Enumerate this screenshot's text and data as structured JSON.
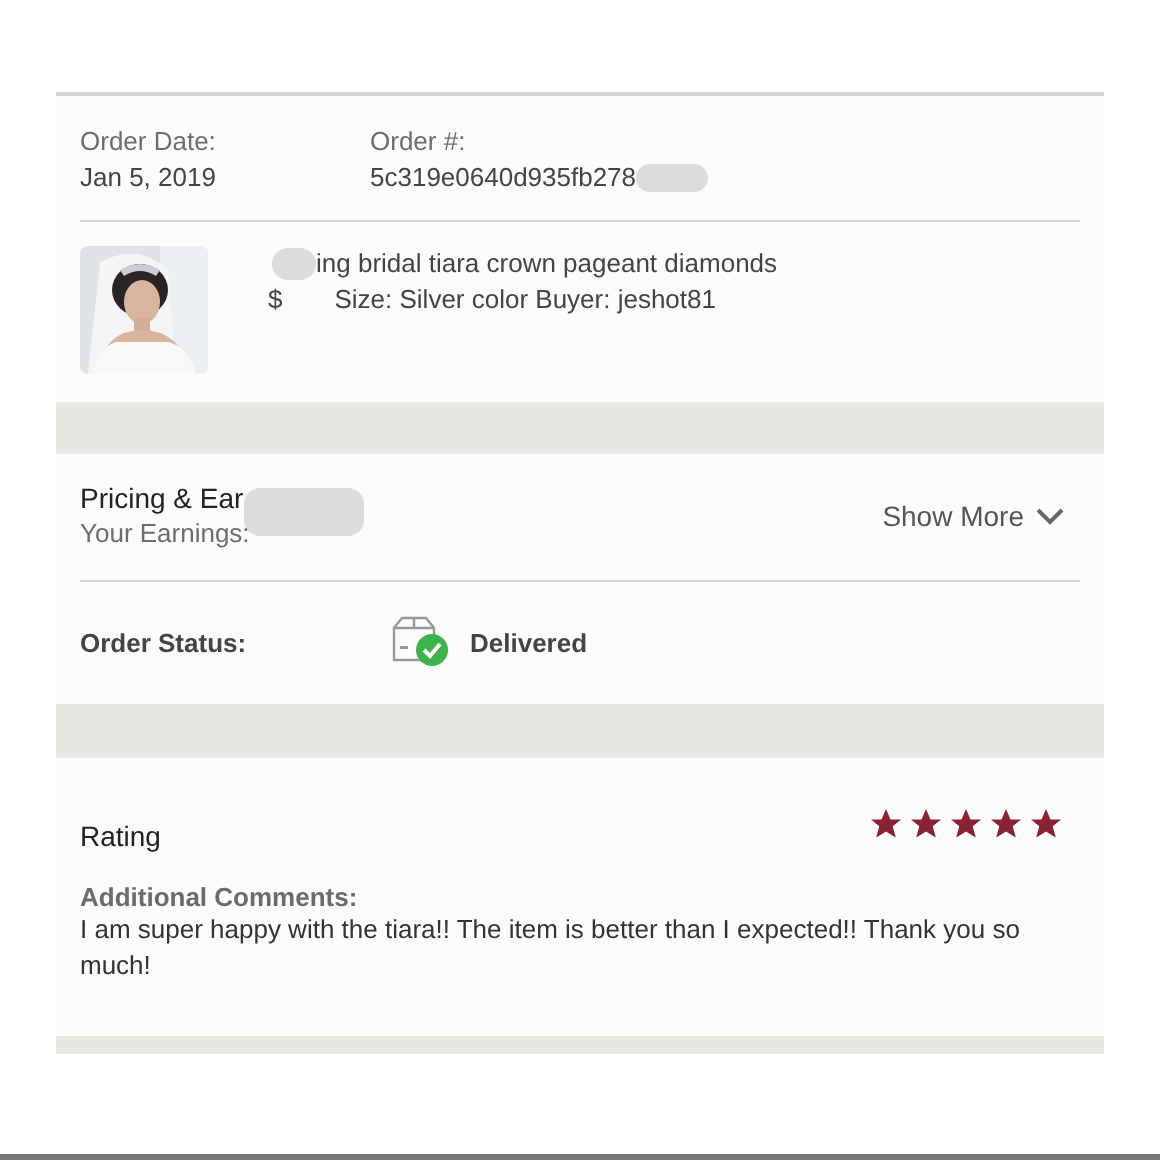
{
  "order": {
    "date_label": "Order Date:",
    "date": "Jan 5, 2019",
    "number_label": "Order #:",
    "number": "5c319e0640d935fb278"
  },
  "item": {
    "title": "ing bridal tiara crown pageant diamonds",
    "price_prefix": "$",
    "details": "Size: Silver color  Buyer: jeshot81"
  },
  "pricing": {
    "title": "Pricing & Ear",
    "earnings_label": "Your Earnings:",
    "toggle": "Show More"
  },
  "status": {
    "label": "Order Status:",
    "value": "Delivered"
  },
  "rating": {
    "title": "Rating",
    "stars": 5,
    "comments_label": "Additional Comments:",
    "comments": "I am super happy with the tiara!! The item is better than I expected!! Thank you so much!"
  }
}
